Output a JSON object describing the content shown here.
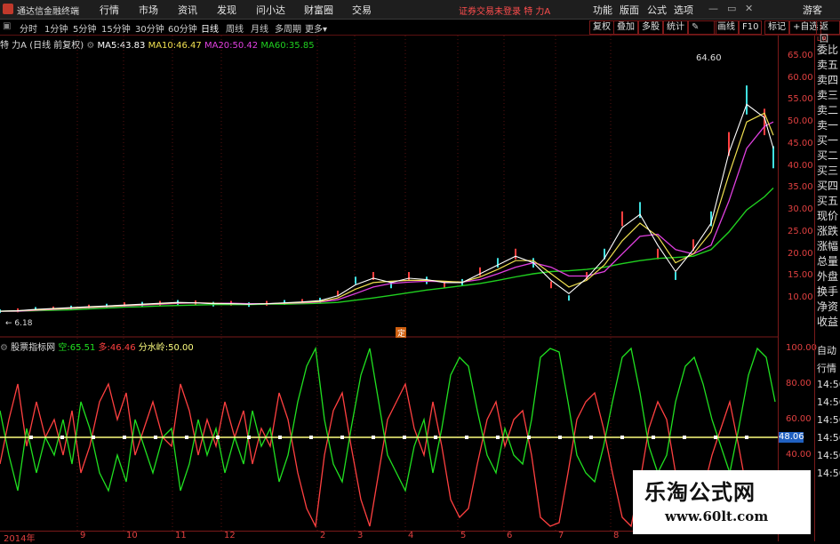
{
  "titlebar": {
    "app_title": "通达信金融终端",
    "menus": [
      "行情",
      "市场",
      "资讯",
      "发现",
      "问小达",
      "财富圈",
      "交易"
    ],
    "login_status": "证券交易未登录",
    "stock_name": "特 力A",
    "right_menus": [
      "功能",
      "版面",
      "公式",
      "选项"
    ],
    "guest": "游客"
  },
  "toolbar": {
    "periods": [
      "分时",
      "1分钟",
      "5分钟",
      "15分钟",
      "30分钟",
      "60分钟",
      "日线",
      "周线",
      "月线",
      "多周期",
      "更多"
    ],
    "active_period": "日线",
    "buttons": [
      "复权",
      "叠加",
      "多股",
      "统计",
      "画线",
      "F10",
      "标记",
      "+自选",
      "返回"
    ]
  },
  "ma_info": {
    "stock": "特 力A",
    "mode": "(日线 前复权)",
    "ma5_label": "MA5:",
    "ma5": "43.83",
    "ma10_label": "MA10:",
    "ma10": "46.47",
    "ma20_label": "MA20:",
    "ma20": "50.42",
    "ma60_label": "MA60:",
    "ma60": "35.85"
  },
  "annotations": {
    "high": "64.60",
    "low": "6.18",
    "marker": "定"
  },
  "indicator": {
    "name": "股票指标网",
    "kong_label": "空:",
    "kong": "65.51",
    "duo_label": "多:",
    "duo": "46.46",
    "water_label": "分水岭:",
    "water": "50.00",
    "current_value_tag": "48.06"
  },
  "y_axis_main": [
    "65.00",
    "60.00",
    "55.00",
    "50.00",
    "45.00",
    "40.00",
    "35.00",
    "30.00",
    "25.00",
    "20.00",
    "15.00",
    "10.00"
  ],
  "y_axis_indicator": [
    "100.00",
    "80.00",
    "60.00",
    "40.00"
  ],
  "side_panel": {
    "header": "L R",
    "items": [
      "委比",
      "卖五",
      "卖四",
      "卖三",
      "卖二",
      "卖一",
      "买一",
      "买二",
      "买三",
      "买四",
      "买五",
      "现价",
      "涨跌",
      "涨幅",
      "总量",
      "外盘",
      "换手",
      "净资",
      "收益"
    ],
    "bottom_items": [
      "自动",
      "行情",
      "14:56",
      "14:56",
      "14:56",
      "14:56",
      "14:56",
      "14:56"
    ]
  },
  "x_axis": [
    "2014年",
    "9",
    "10",
    "11",
    "12",
    "2",
    "3",
    "4",
    "5",
    "6",
    "7",
    "8"
  ],
  "watermark": {
    "cn": "乐淘公式网",
    "url": "www.60lt.com"
  },
  "colors": {
    "ma5": "#ffffff",
    "ma10": "#f0e050",
    "ma20": "#e040e0",
    "ma60": "#20d020",
    "kong": "#20e020",
    "duo": "#ff4040",
    "water": "#ffff80",
    "axis": "#e04040",
    "grid": "#7a1a1a"
  },
  "chart_data": {
    "type": "line",
    "main": {
      "price_range": [
        6.18,
        64.6
      ],
      "x": [
        0,
        20,
        40,
        60,
        80,
        100,
        120,
        140,
        160,
        180,
        200,
        220,
        240,
        260,
        280,
        300,
        320,
        340,
        360,
        380,
        400,
        420,
        440,
        460,
        480,
        500,
        520,
        540,
        560,
        580,
        600,
        620,
        640,
        660,
        680,
        700,
        720,
        740,
        760,
        780,
        800,
        820,
        840,
        860,
        870
      ],
      "close": [
        7,
        7.2,
        7.5,
        7.6,
        7.8,
        8,
        8.2,
        8.5,
        8.6,
        8.8,
        9,
        8.9,
        8.6,
        8.8,
        8.5,
        8.8,
        9,
        9.2,
        9.5,
        11,
        14,
        15,
        13,
        15,
        14,
        13,
        13.5,
        16,
        18,
        20,
        18,
        13,
        10,
        15,
        20,
        28,
        30,
        20,
        15,
        22,
        28,
        45,
        55,
        50,
        42
      ],
      "ma5": [
        7,
        7.1,
        7.4,
        7.6,
        7.8,
        8,
        8.2,
        8.4,
        8.6,
        8.8,
        9,
        8.9,
        8.7,
        8.7,
        8.6,
        8.7,
        8.9,
        9.1,
        9.4,
        10.5,
        13,
        14.5,
        13.5,
        14.5,
        14.2,
        13.5,
        13.5,
        15.5,
        17.5,
        19.5,
        18,
        14,
        11,
        14.5,
        19,
        26,
        29,
        22,
        16,
        21,
        27,
        43,
        54,
        51,
        44
      ],
      "ma10": [
        7,
        7.1,
        7.3,
        7.5,
        7.7,
        7.9,
        8.1,
        8.3,
        8.5,
        8.7,
        8.9,
        8.9,
        8.8,
        8.7,
        8.6,
        8.7,
        8.8,
        9,
        9.2,
        10,
        12,
        13.5,
        13.8,
        14,
        14,
        13.8,
        13.6,
        14.8,
        16.5,
        18.5,
        18.5,
        15.5,
        12.5,
        14,
        17.5,
        23,
        27,
        24,
        18,
        20,
        25,
        38,
        50,
        52,
        47
      ],
      "ma20": [
        7,
        7,
        7.2,
        7.4,
        7.6,
        7.8,
        8,
        8.2,
        8.4,
        8.6,
        8.8,
        8.9,
        8.8,
        8.8,
        8.7,
        8.7,
        8.8,
        8.9,
        9.1,
        9.6,
        11,
        12.5,
        13.3,
        13.6,
        13.8,
        13.7,
        13.6,
        14.2,
        15.5,
        17,
        18,
        17,
        15,
        15,
        16,
        20,
        24,
        24.5,
        21,
        20,
        22,
        32,
        44,
        49,
        50
      ],
      "ma60": [
        7,
        7,
        7.1,
        7.2,
        7.3,
        7.5,
        7.7,
        7.9,
        8,
        8.2,
        8.3,
        8.4,
        8.5,
        8.5,
        8.5,
        8.6,
        8.6,
        8.7,
        8.8,
        9,
        9.5,
        10,
        10.6,
        11.2,
        11.8,
        12.3,
        12.8,
        13.3,
        14,
        14.8,
        15.5,
        16,
        16.2,
        16.5,
        17,
        17.8,
        18.5,
        19,
        19.2,
        19.5,
        21,
        25,
        30,
        33,
        35
      ]
    },
    "indicator": {
      "y_range": [
        0,
        100
      ],
      "kong": [
        65,
        40,
        20,
        55,
        30,
        50,
        40,
        60,
        35,
        70,
        55,
        30,
        20,
        40,
        25,
        60,
        45,
        30,
        50,
        55,
        20,
        35,
        60,
        40,
        55,
        30,
        50,
        35,
        65,
        45,
        55,
        25,
        40,
        70,
        90,
        100,
        60,
        35,
        25,
        55,
        85,
        100,
        70,
        40,
        30,
        20,
        45,
        60,
        30,
        55,
        85,
        95,
        90,
        65,
        40,
        30,
        55,
        40,
        35,
        60,
        95,
        100,
        98,
        70,
        40,
        30,
        25,
        45,
        70,
        95,
        100,
        75,
        45,
        30,
        40,
        70,
        90,
        95,
        80,
        60,
        45,
        30,
        55,
        85,
        100,
        95,
        70
      ],
      "duo": [
        35,
        60,
        80,
        45,
        70,
        50,
        60,
        40,
        65,
        30,
        45,
        70,
        80,
        60,
        75,
        40,
        55,
        70,
        50,
        45,
        80,
        65,
        40,
        60,
        45,
        70,
        50,
        65,
        35,
        55,
        45,
        75,
        60,
        30,
        10,
        0,
        40,
        65,
        75,
        45,
        15,
        0,
        30,
        60,
        70,
        80,
        55,
        40,
        70,
        45,
        15,
        5,
        10,
        35,
        60,
        70,
        45,
        60,
        65,
        40,
        5,
        0,
        2,
        30,
        60,
        70,
        75,
        55,
        30,
        5,
        0,
        25,
        55,
        70,
        60,
        30,
        10,
        5,
        20,
        40,
        55,
        70,
        45,
        15,
        0,
        5,
        30
      ],
      "water": 50
    }
  }
}
